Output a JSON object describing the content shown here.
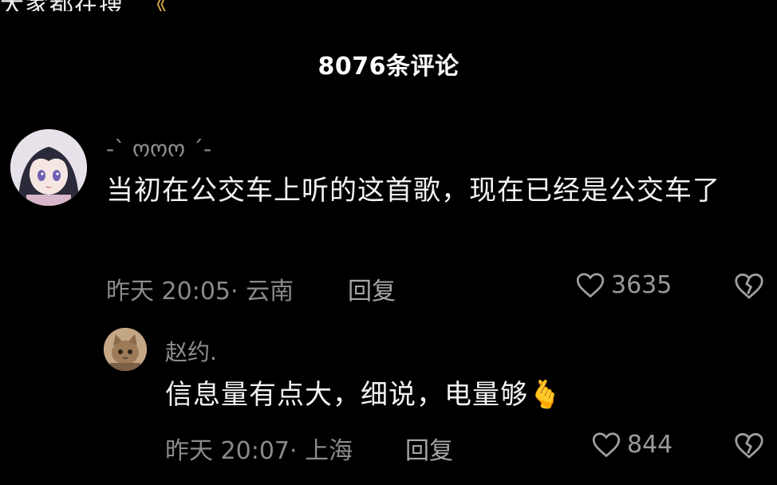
{
  "header": {
    "title": "8076条评论"
  },
  "comments": [
    {
      "username": "-` ოოო ´-",
      "text": "当初在公交车上听的这首歌，现在已经是公交车了",
      "time": "昨天 20:05",
      "location": "· 云南",
      "reply_label": "回复",
      "likes": "3635",
      "avatar_icon": "anime-girl-avatar"
    },
    {
      "username": "赵约.",
      "text": "信息量有点大，细说，电量够",
      "emoji": "🫰",
      "time": "昨天 20:07",
      "location": "· 上海",
      "reply_label": "回复",
      "likes": "844",
      "avatar_icon": "cat-avatar"
    }
  ],
  "icons": {
    "like": "heart-outline-icon",
    "dislike": "broken-heart-icon"
  },
  "colors": {
    "background": "#000000",
    "text_primary": "#f3f3f3",
    "text_secondary": "#8a8a8a"
  }
}
